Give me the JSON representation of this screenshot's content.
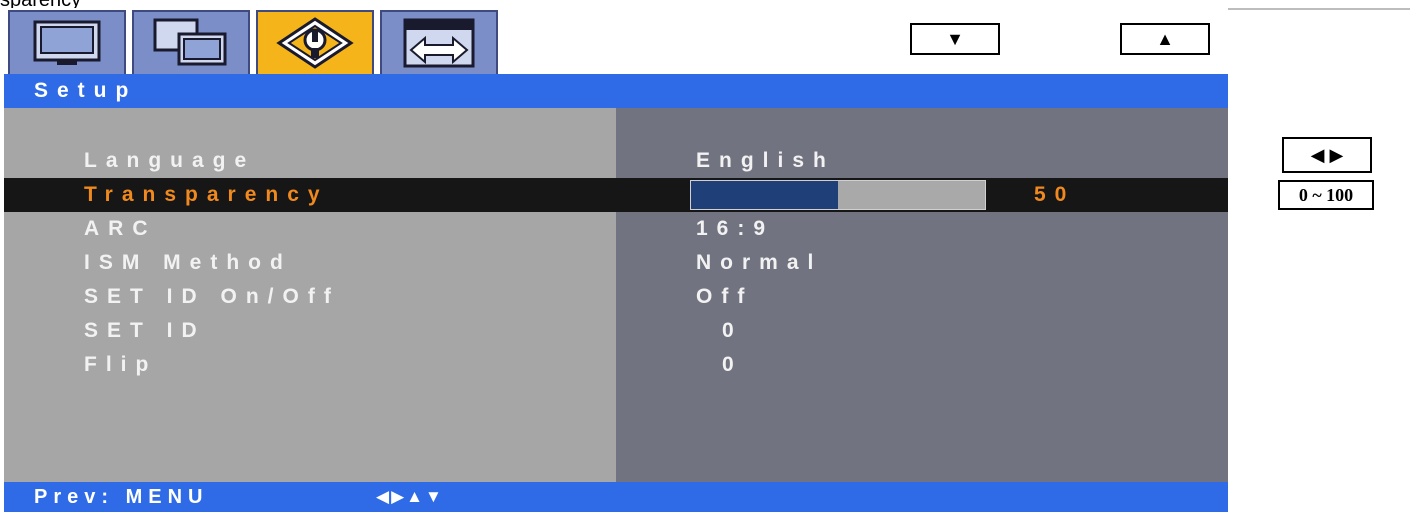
{
  "window": {
    "partial_caption": "sparency"
  },
  "tabs": [
    {
      "name": "picture",
      "icon": "monitor-icon",
      "active": false
    },
    {
      "name": "pip",
      "icon": "multi-screen-icon",
      "active": false
    },
    {
      "name": "setup",
      "icon": "setup-wrench-icon",
      "active": true
    },
    {
      "name": "position",
      "icon": "position-arrows-icon",
      "active": false
    }
  ],
  "nav": {
    "down": "▼",
    "up": "▲"
  },
  "header": {
    "title": "Setup"
  },
  "menu": {
    "items": [
      {
        "label": "Language",
        "value": "English",
        "selected": false
      },
      {
        "label": "Transparency",
        "value": "50",
        "selected": true,
        "level_percent": 50
      },
      {
        "label": "ARC",
        "value": "16:9",
        "selected": false
      },
      {
        "label": "ISM Method",
        "value": "Normal",
        "selected": false
      },
      {
        "label": "SET ID On/Off",
        "value": "Off",
        "selected": false
      },
      {
        "label": "SET ID",
        "value": "0",
        "selected": false
      },
      {
        "label": "Flip",
        "value": "0",
        "selected": false
      }
    ]
  },
  "footer": {
    "prev": "Prev: MENU",
    "arrows": "◀▶▲▼"
  },
  "side": {
    "adjust": "◀ ▶",
    "range": "0 ~ 100"
  },
  "colors": {
    "header": "#2f6be6",
    "selected_text": "#f08a1e",
    "active_tab": "#f5b51a",
    "inactive_tab": "#7b8ec8",
    "slider_fill": "#1f3f78"
  }
}
